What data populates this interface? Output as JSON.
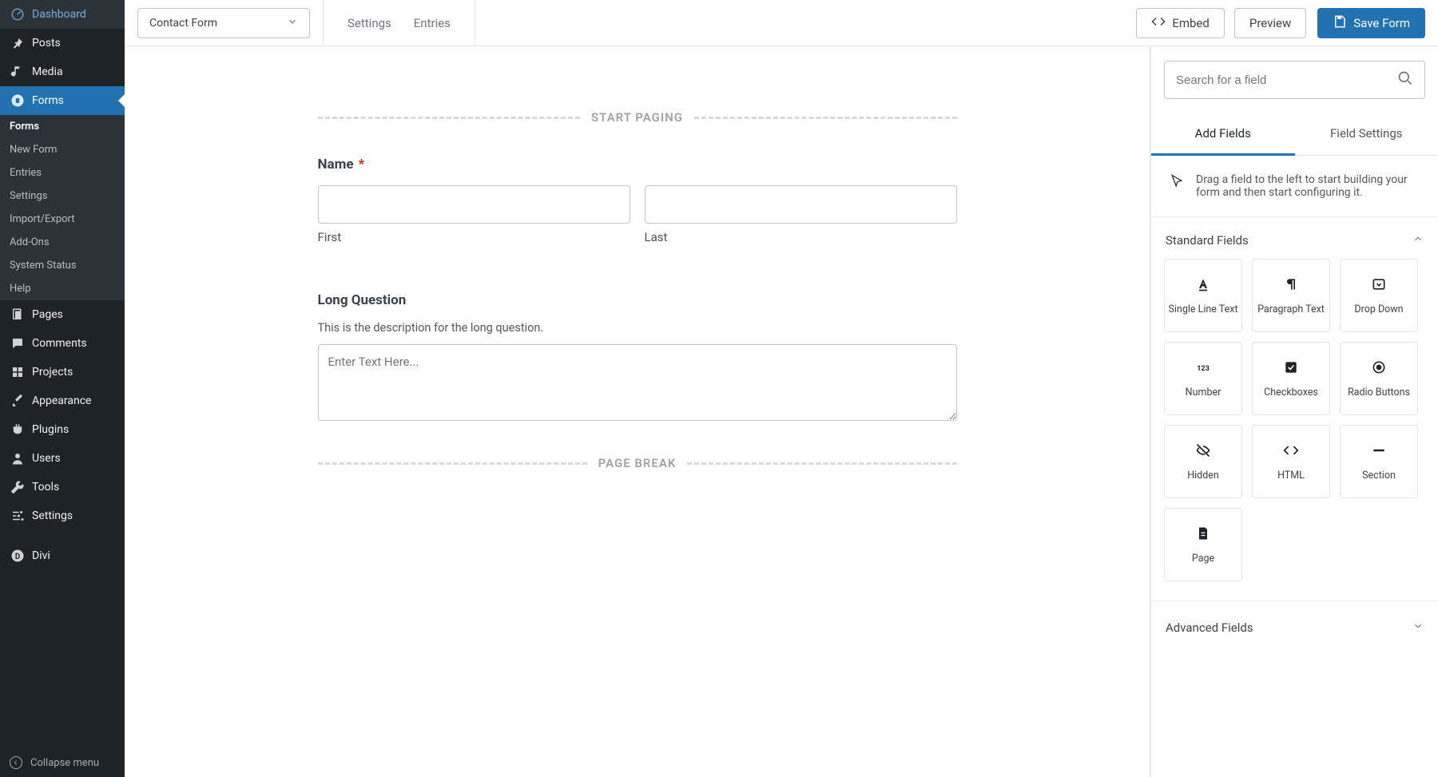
{
  "sidebar": {
    "items": [
      {
        "label": "Dashboard"
      },
      {
        "label": "Posts"
      },
      {
        "label": "Media"
      },
      {
        "label": "Forms"
      },
      {
        "label": "Pages"
      },
      {
        "label": "Comments"
      },
      {
        "label": "Projects"
      },
      {
        "label": "Appearance"
      },
      {
        "label": "Plugins"
      },
      {
        "label": "Users"
      },
      {
        "label": "Tools"
      },
      {
        "label": "Settings"
      },
      {
        "label": "Divi"
      }
    ],
    "submenu": [
      {
        "label": "Forms"
      },
      {
        "label": "New Form"
      },
      {
        "label": "Entries"
      },
      {
        "label": "Settings"
      },
      {
        "label": "Import/Export"
      },
      {
        "label": "Add-Ons"
      },
      {
        "label": "System Status"
      },
      {
        "label": "Help"
      }
    ],
    "collapse": "Collapse menu"
  },
  "topbar": {
    "formName": "Contact Form",
    "settings": "Settings",
    "entries": "Entries",
    "embed": "Embed",
    "preview": "Preview",
    "save": "Save Form"
  },
  "canvas": {
    "startPaging": "START PAGING",
    "pageBreak": "PAGE BREAK",
    "nameLabel": "Name",
    "firstLabel": "First",
    "lastLabel": "Last",
    "longLabel": "Long Question",
    "longDesc": "This is the description for the long question.",
    "longPlaceholder": "Enter Text Here..."
  },
  "right": {
    "searchPlaceholder": "Search for a field",
    "tabAdd": "Add Fields",
    "tabSettings": "Field Settings",
    "hint": "Drag a field to the left to start building your form and then start configuring it.",
    "standard": "Standard Fields",
    "advanced": "Advanced Fields",
    "fields": [
      "Single Line Text",
      "Paragraph Text",
      "Drop Down",
      "Number",
      "Checkboxes",
      "Radio Buttons",
      "Hidden",
      "HTML",
      "Section",
      "Page"
    ]
  }
}
